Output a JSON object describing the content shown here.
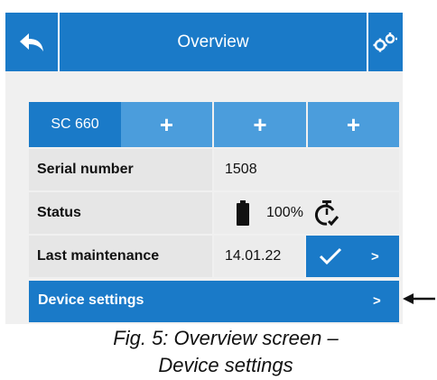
{
  "header": {
    "title": "Overview",
    "back_icon": "back-arrow-icon",
    "settings_icon": "gears-icon"
  },
  "tabs": [
    {
      "label": "SC 660"
    },
    {
      "label": "+"
    },
    {
      "label": "+"
    },
    {
      "label": "+"
    }
  ],
  "rows": {
    "serial": {
      "label": "Serial number",
      "value": "1508"
    },
    "status": {
      "label": "Status",
      "battery": "100%",
      "battery_icon": "battery-icon",
      "timer_icon": "timer-check-icon"
    },
    "maintenance": {
      "label": "Last maintenance",
      "value": "14.01.22",
      "check_icon": "checkmark-icon",
      "go": ">"
    }
  },
  "device_settings": {
    "label": "Device settings",
    "go": ">"
  },
  "caption": {
    "line1": "Fig. 5: Overview screen –",
    "line2": "Device settings"
  },
  "colors": {
    "accent": "#1a7ac8",
    "accent_light": "#4b9ddc",
    "row_bg": "#e6e6e6"
  }
}
